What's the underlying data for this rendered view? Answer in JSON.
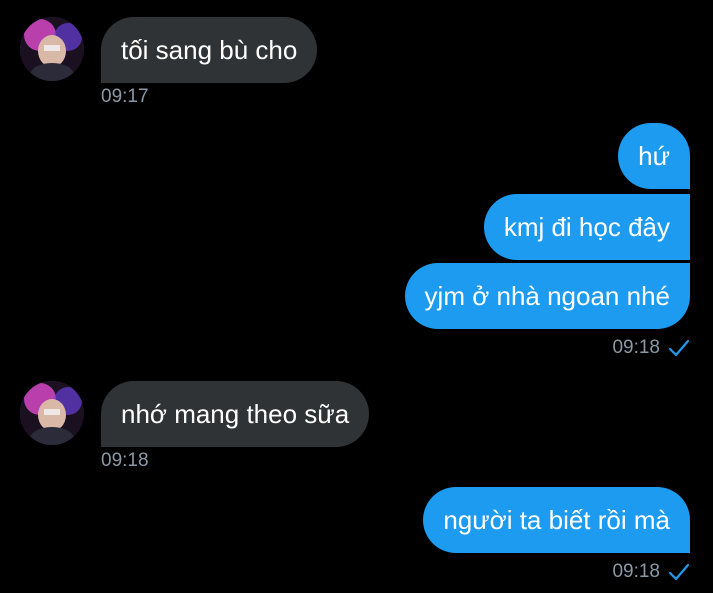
{
  "colors": {
    "background": "#000000",
    "incoming_bubble": "#2f3336",
    "outgoing_bubble": "#1d9bf0",
    "timestamp": "#8b98a5",
    "read_check": "#1d9bf0"
  },
  "messages": [
    {
      "direction": "incoming",
      "text": "tối sang bù cho",
      "time": "09:17"
    },
    {
      "direction": "outgoing",
      "text": "hứ"
    },
    {
      "direction": "outgoing",
      "text": "kmj đi học đây"
    },
    {
      "direction": "outgoing",
      "text": "yjm ở nhà ngoan nhé",
      "time": "09:18",
      "status_icon": "check-icon"
    },
    {
      "direction": "incoming",
      "text": "nhớ mang theo sữa",
      "time": "09:18"
    },
    {
      "direction": "outgoing",
      "text": "người ta biết rồi mà",
      "time": "09:18",
      "status_icon": "check-icon"
    }
  ]
}
